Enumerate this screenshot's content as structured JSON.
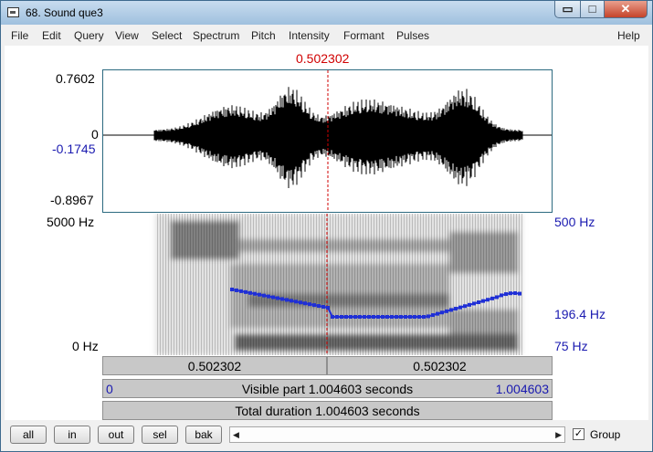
{
  "window": {
    "title": "68. Sound que3",
    "controls": {
      "minimize": "▭",
      "maximize": "□",
      "close": "✕"
    }
  },
  "menu": [
    "File",
    "Edit",
    "Query",
    "View",
    "Select",
    "Spectrum",
    "Pitch",
    "Intensity",
    "Formant",
    "Pulses",
    "Help"
  ],
  "cursor": {
    "time_label": "0.502302",
    "color": "#d00000"
  },
  "waveform": {
    "max_label": "0.7602",
    "zero_label": "0",
    "cursor_value_label": "-0.1745",
    "min_label": "-0.8967"
  },
  "spectrogram": {
    "top_freq_label": "5000 Hz",
    "bottom_freq_label": "0 Hz",
    "pitch_top_label": "500 Hz",
    "pitch_cursor_label": "196.4 Hz",
    "pitch_bottom_label": "75 Hz",
    "pitch_color": "#1f2fd6"
  },
  "time_bars": {
    "left_segment": "0.502302",
    "right_segment": "0.502302",
    "visible_start": "0",
    "visible_label": "Visible part 1.004603 seconds",
    "visible_end": "1.004603",
    "total_label": "Total duration 1.004603 seconds"
  },
  "bottom": {
    "buttons": {
      "all": "all",
      "in": "in",
      "out": "out",
      "sel": "sel",
      "bak": "bak"
    },
    "scroll_left": "◀",
    "scroll_right": "▶",
    "group_checked": true,
    "group_label": "Group"
  }
}
